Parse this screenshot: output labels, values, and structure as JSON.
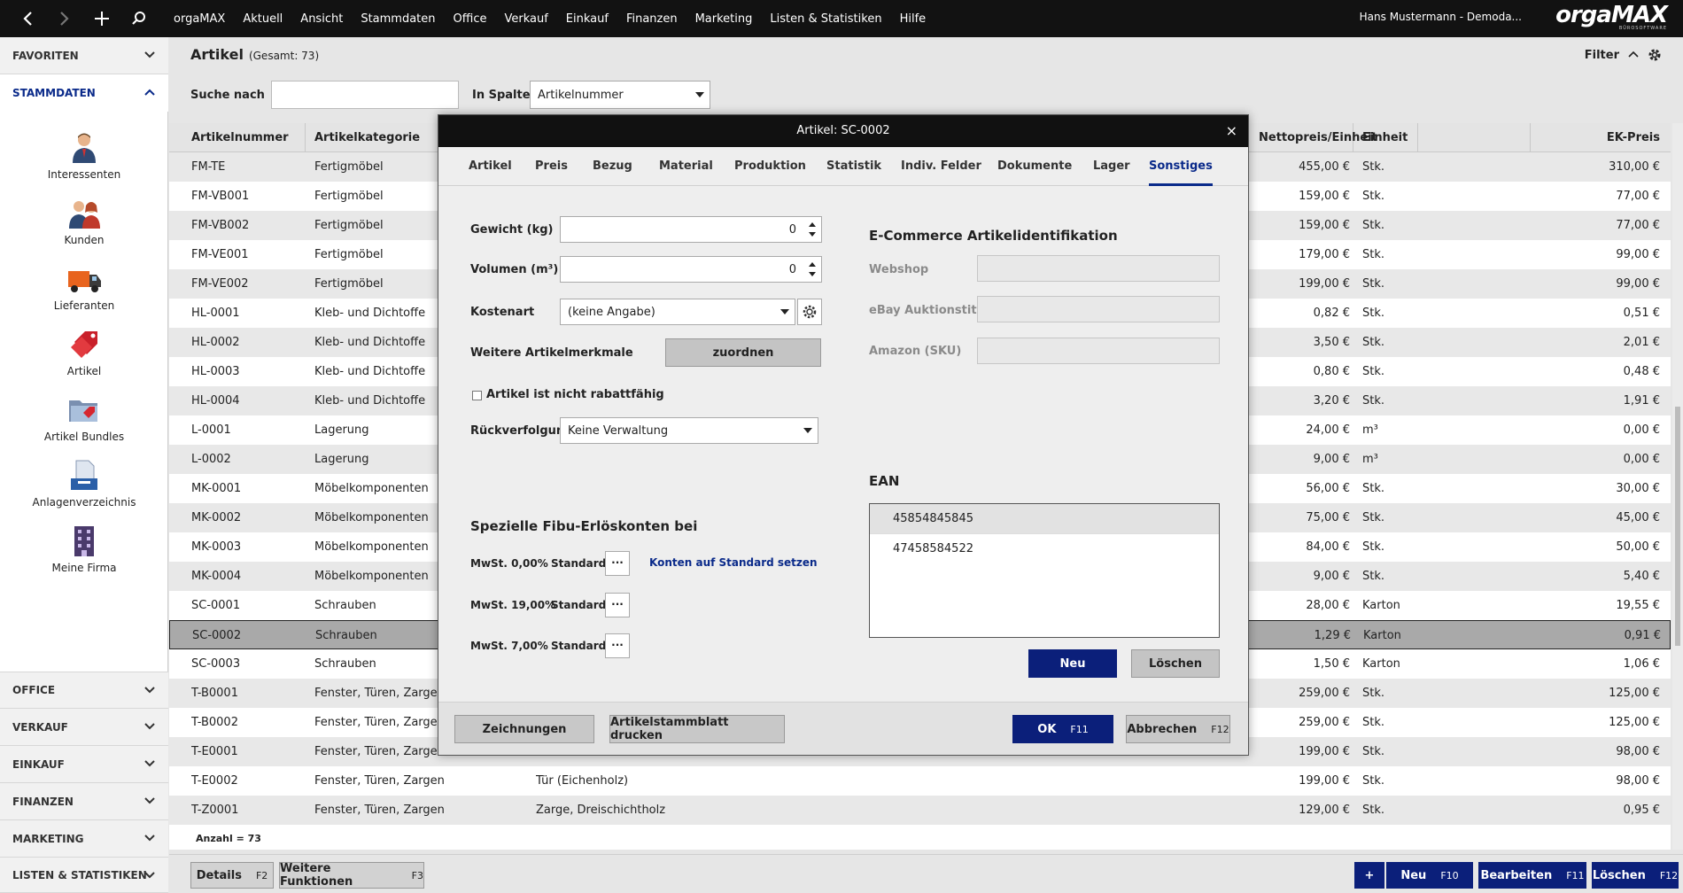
{
  "topbar": {
    "menu": [
      "orgaMAX",
      "Aktuell",
      "Ansicht",
      "Stammdaten",
      "Office",
      "Verkauf",
      "Einkauf",
      "Finanzen",
      "Marketing",
      "Listen & Statistiken",
      "Hilfe"
    ],
    "user": "Hans Mustermann - Demoda...",
    "logo_prefix": "orga",
    "logo_suffix": "MAX",
    "logo_sub": "BÜROSOFTWARE"
  },
  "sidebar": {
    "favoriten": "FAVORITEN",
    "stammdaten": "STAMMDATEN",
    "items": [
      "Interessenten",
      "Kunden",
      "Lieferanten",
      "Artikel",
      "Artikel Bundles",
      "Anlagenverzeichnis",
      "Meine Firma"
    ],
    "sections": [
      "OFFICE",
      "VERKAUF",
      "EINKAUF",
      "FINANZEN",
      "MARKETING",
      "LISTEN & STATISTIKEN"
    ]
  },
  "main": {
    "title": "Artikel",
    "total": "(Gesamt: 73)",
    "filter": "Filter",
    "search_label": "Suche nach",
    "search_value": "",
    "column_label": "In Spalte",
    "column_value": "Artikelnummer",
    "count": "Anzahl = 73",
    "columns": {
      "nr": "Artikelnummer",
      "kat": "Artikelkategorie",
      "netto": "Nettopreis/Einheit",
      "einheit": "Einheit",
      "ek": "EK-Preis"
    },
    "rows": [
      {
        "nr": "FM-TE",
        "kat": "Fertigmöbel",
        "bez": "",
        "netto": "455,00 €",
        "einheit": "Stk.",
        "ek": "310,00 €"
      },
      {
        "nr": "FM-VB001",
        "kat": "Fertigmöbel",
        "bez": "",
        "netto": "159,00 €",
        "einheit": "Stk.",
        "ek": "77,00 €"
      },
      {
        "nr": "FM-VB002",
        "kat": "Fertigmöbel",
        "bez": "",
        "netto": "159,00 €",
        "einheit": "Stk.",
        "ek": "77,00 €"
      },
      {
        "nr": "FM-VE001",
        "kat": "Fertigmöbel",
        "bez": "",
        "netto": "179,00 €",
        "einheit": "Stk.",
        "ek": "99,00 €"
      },
      {
        "nr": "FM-VE002",
        "kat": "Fertigmöbel",
        "bez": "",
        "netto": "199,00 €",
        "einheit": "Stk.",
        "ek": "99,00 €"
      },
      {
        "nr": "HL-0001",
        "kat": "Kleb- und Dichtoffe",
        "bez": "",
        "netto": "0,82 €",
        "einheit": "Stk.",
        "ek": "0,51 €"
      },
      {
        "nr": "HL-0002",
        "kat": "Kleb- und Dichtoffe",
        "bez": "",
        "netto": "3,50 €",
        "einheit": "Stk.",
        "ek": "2,01 €"
      },
      {
        "nr": "HL-0003",
        "kat": "Kleb- und Dichtoffe",
        "bez": "",
        "netto": "0,80 €",
        "einheit": "Stk.",
        "ek": "0,48 €"
      },
      {
        "nr": "HL-0004",
        "kat": "Kleb- und Dichtoffe",
        "bez": "",
        "netto": "3,20 €",
        "einheit": "Stk.",
        "ek": "1,91 €"
      },
      {
        "nr": "L-0001",
        "kat": "Lagerung",
        "bez": "",
        "netto": "24,00 €",
        "einheit": "m³",
        "ek": "0,00 €"
      },
      {
        "nr": "L-0002",
        "kat": "Lagerung",
        "bez": "",
        "netto": "9,00 €",
        "einheit": "m³",
        "ek": "0,00 €"
      },
      {
        "nr": "MK-0001",
        "kat": "Möbelkomponenten",
        "bez": "",
        "netto": "56,00 €",
        "einheit": "Stk.",
        "ek": "30,00 €"
      },
      {
        "nr": "MK-0002",
        "kat": "Möbelkomponenten",
        "bez": "",
        "netto": "75,00 €",
        "einheit": "Stk.",
        "ek": "45,00 €"
      },
      {
        "nr": "MK-0003",
        "kat": "Möbelkomponenten",
        "bez": "",
        "netto": "84,00 €",
        "einheit": "Stk.",
        "ek": "50,00 €"
      },
      {
        "nr": "MK-0004",
        "kat": "Möbelkomponenten",
        "bez": "",
        "netto": "9,00 €",
        "einheit": "Stk.",
        "ek": "5,40 €"
      },
      {
        "nr": "SC-0001",
        "kat": "Schrauben",
        "bez": "",
        "netto": "28,00 €",
        "einheit": "Karton",
        "ek": "19,55 €"
      },
      {
        "nr": "SC-0002",
        "kat": "Schrauben",
        "bez": "",
        "netto": "1,29 €",
        "einheit": "Karton",
        "ek": "0,91 €"
      },
      {
        "nr": "SC-0003",
        "kat": "Schrauben",
        "bez": "",
        "netto": "1,50 €",
        "einheit": "Karton",
        "ek": "1,06 €"
      },
      {
        "nr": "T-B0001",
        "kat": "Fenster, Türen, Zargen",
        "bez": "",
        "netto": "259,00 €",
        "einheit": "Stk.",
        "ek": "125,00 €"
      },
      {
        "nr": "T-B0002",
        "kat": "Fenster, Türen, Zargen",
        "bez": "",
        "netto": "259,00 €",
        "einheit": "Stk.",
        "ek": "125,00 €"
      },
      {
        "nr": "T-E0001",
        "kat": "Fenster, Türen, Zargen",
        "bez": "",
        "netto": "199,00 €",
        "einheit": "Stk.",
        "ek": "98,00 €"
      },
      {
        "nr": "T-E0002",
        "kat": "Fenster, Türen, Zargen",
        "bez": "Tür (Eichenholz)",
        "netto": "199,00 €",
        "einheit": "Stk.",
        "ek": "98,00 €"
      },
      {
        "nr": "T-Z0001",
        "kat": "Fenster, Türen, Zargen",
        "bez": "Zarge, Dreischichtholz",
        "netto": "129,00 €",
        "einheit": "Stk.",
        "ek": "0,95 €"
      }
    ]
  },
  "bottom": {
    "details": "Details",
    "details_key": "F2",
    "weitere": "Weitere Funktionen",
    "weitere_key": "F3",
    "plus": "+",
    "neu": "Neu",
    "neu_key": "F10",
    "bearbeiten": "Bearbeiten",
    "bearbeiten_key": "F11",
    "loeschen": "Löschen",
    "loeschen_key": "F12"
  },
  "dialog": {
    "title": "Artikel: SC-0002",
    "close": "×",
    "tabs": [
      "Artikel",
      "Preis",
      "Bezug",
      "Material",
      "Produktion",
      "Statistik",
      "Indiv. Felder",
      "Dokumente",
      "Lager",
      "Sonstiges"
    ],
    "gewicht_label": "Gewicht (kg)",
    "gewicht_value": "0",
    "volumen_label": "Volumen (m³)",
    "volumen_value": "0",
    "kostenart_label": "Kostenart",
    "kostenart_value": "(keine Angabe)",
    "merkmale_label": "Weitere Artikelmerkmale",
    "zuordnen": "zuordnen",
    "rabatt_label": "Artikel ist nicht rabattfähig",
    "rueck_label": "Rückverfolgung",
    "rueck_value": "Keine Verwaltung",
    "fibu_title": "Spezielle Fibu-Erlöskonten bei",
    "mwst": [
      {
        "label": "MwSt. 0,00%",
        "value": "Standard"
      },
      {
        "label": "MwSt. 19,00%",
        "value": "Standard"
      },
      {
        "label": "MwSt. 7,00%",
        "value": "Standard"
      }
    ],
    "dots": "···",
    "konten_link": "Konten auf Standard setzen",
    "ecom_title": "E-Commerce Artikelidentifikation",
    "webshop": "Webshop",
    "ebay": "eBay Auktionstitel",
    "amazon": "Amazon (SKU)",
    "ean_title": "EAN",
    "ean_values": [
      "45854845845",
      "47458584522"
    ],
    "ean_neu": "Neu",
    "ean_loeschen": "Löschen",
    "zeichnungen": "Zeichnungen",
    "drucken": "Artikelstammblatt drucken",
    "ok": "OK",
    "ok_key": "F11",
    "abbrechen": "Abbrechen",
    "abbrechen_key": "F12"
  },
  "colors": {
    "accent": "#0b1f7a",
    "topbar": "#121212",
    "selected_row": "#a9a9a9"
  }
}
